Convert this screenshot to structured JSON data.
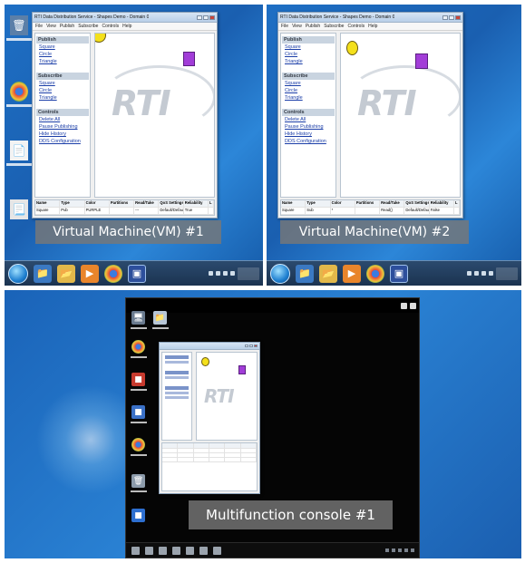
{
  "captions": {
    "vm1": "Virtual Machine(VM) #1",
    "vm2": "Virtual Machine(VM) #2",
    "console": "Multifunction console #1"
  },
  "app": {
    "title": "RTI Data Distribution Service - Shapes Demo - Domain 0",
    "menu": [
      "File",
      "View",
      "Publish",
      "Subscribe",
      "Controls",
      "Help"
    ],
    "sections": [
      {
        "header": "Publish",
        "links": [
          "Square",
          "Circle",
          "Triangle"
        ]
      },
      {
        "header": "Subscribe",
        "links": [
          "Square",
          "Circle",
          "Triangle"
        ]
      },
      {
        "header": "Controls",
        "links": [
          "Delete All",
          "Pause Publishing",
          "Hide History",
          "DDS Configuration"
        ]
      }
    ],
    "logo_text": "RTI",
    "table_headers": [
      "Name",
      "Type",
      "Color",
      "Partitions",
      "Read/Take",
      "QoS Settings",
      "Reliability",
      "L"
    ],
    "vm1_row": [
      "Square",
      "Pub",
      "PURPLE",
      "",
      "---",
      "Default/Default",
      "True",
      ""
    ],
    "vm2_row": [
      "Square",
      "Sub",
      "*",
      "",
      "Read()",
      "Default/Default",
      "False",
      ""
    ],
    "shape_colors": {
      "circle": "#f4e01b",
      "square": "#a23dd8"
    }
  },
  "desktop": {
    "wallpaper_color": "#1a5fb0",
    "taskbar_color": "#1b3350",
    "icons": [
      "recycle-bin-icon",
      "chrome-icon",
      "file-icon"
    ]
  },
  "console": {
    "background": "#050505"
  }
}
